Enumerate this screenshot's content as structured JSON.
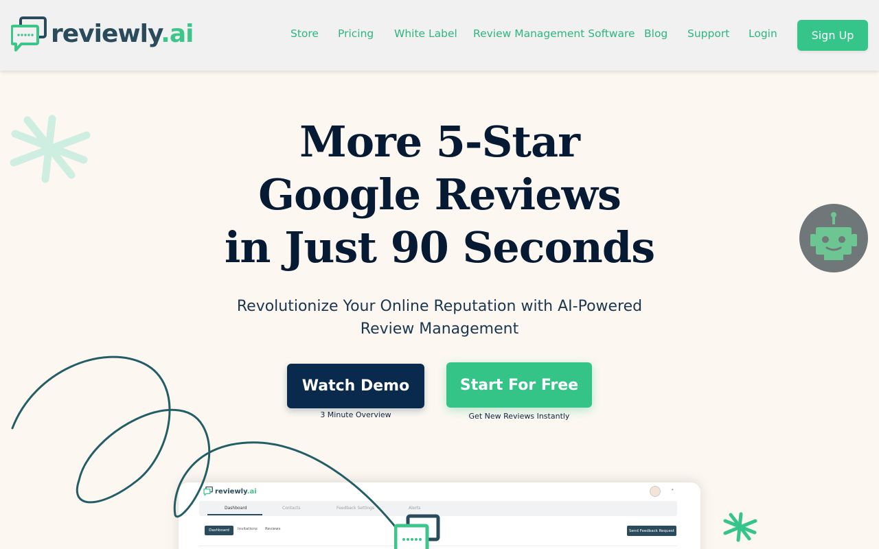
{
  "brand": {
    "name": "reviewly",
    "suffix": ".ai",
    "colors": {
      "navy": "#092a4d",
      "green": "#35c48a",
      "logo_dark": "#2a4b5c"
    }
  },
  "nav": {
    "items": [
      {
        "label": "Store"
      },
      {
        "label": "Pricing"
      },
      {
        "label": "White Label"
      },
      {
        "label": "Review Management Software"
      },
      {
        "label": "Blog"
      },
      {
        "label": "Support"
      },
      {
        "label": "Login"
      }
    ],
    "signup_label": "Sign Up"
  },
  "hero": {
    "title_line1": "More 5-Star",
    "title_line2": "Google Reviews",
    "title_line3": "in Just 90 Seconds",
    "subtitle": "Revolutionize Your Online Reputation with AI-Powered Review Management",
    "demo_button": "Watch Demo",
    "demo_caption": "3 Minute Overview",
    "free_button": "Start For Free",
    "free_caption": "Get New Reviews Instantly"
  },
  "dashboard_preview": {
    "logo_name": "reviewly",
    "logo_suffix": ".ai",
    "tabs": [
      {
        "label": "Dashboard",
        "active": true
      },
      {
        "label": "Contacts",
        "active": false
      },
      {
        "label": "Feedback Settings",
        "active": false
      },
      {
        "label": "Alerts",
        "active": false
      }
    ],
    "subtabs": [
      {
        "label": "Dashboard",
        "active": true
      },
      {
        "label": "Invitations",
        "active": false
      },
      {
        "label": "Reviews",
        "active": false
      }
    ],
    "send_button": "Send Feedback Request"
  },
  "icons": {
    "logo": "chat-bubble-stars-icon",
    "robot": "robot-chat-icon",
    "sparkle_left": "sparkle-icon",
    "sparkle_right": "sparkle-icon"
  }
}
